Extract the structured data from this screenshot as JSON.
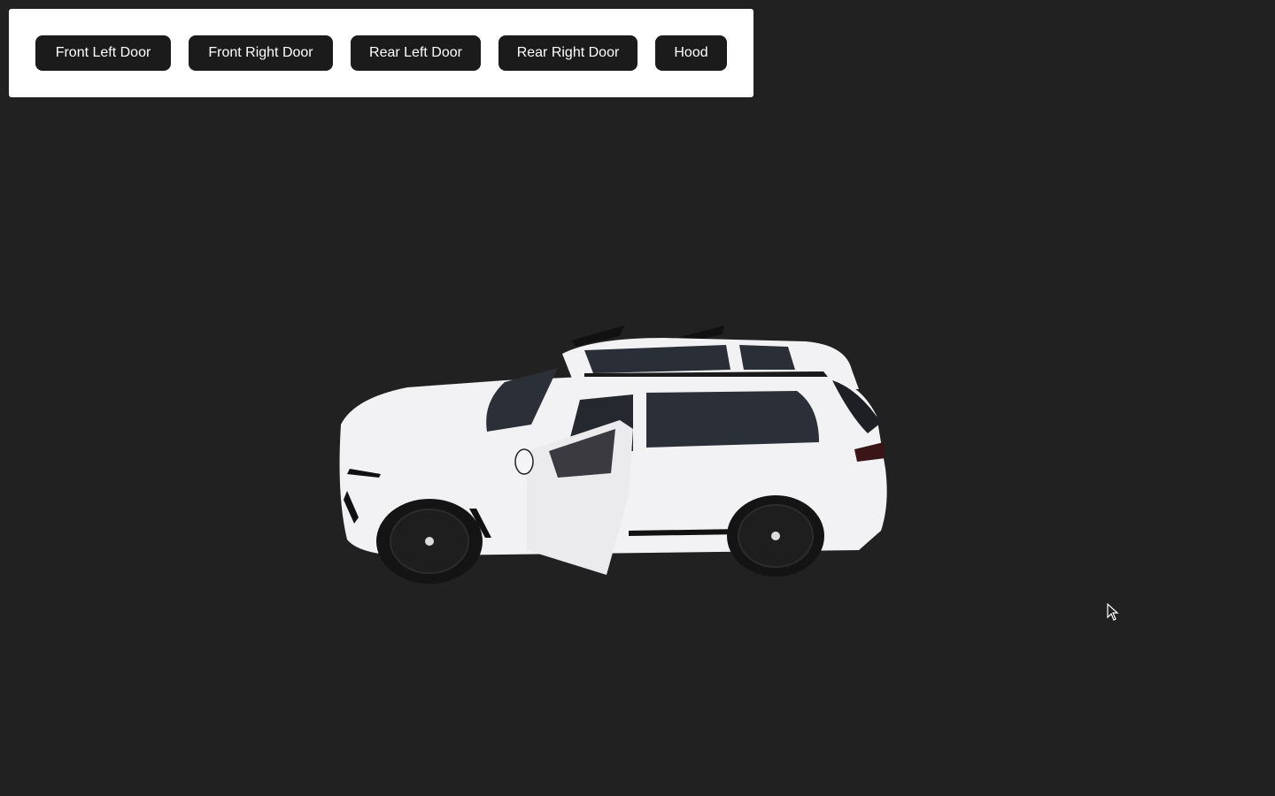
{
  "toolbar": {
    "buttons": [
      {
        "label": "Front Left Door"
      },
      {
        "label": "Front Right Door"
      },
      {
        "label": "Rear Left Door"
      },
      {
        "label": "Rear Right Door"
      },
      {
        "label": "Hood"
      }
    ]
  },
  "scene": {
    "background_color": "#212121",
    "model_icon": "suv-3d-model",
    "car_color": "#f2f2f4",
    "wheel_color": "#151515"
  },
  "cursor_icon": "arrow-pointer-icon"
}
